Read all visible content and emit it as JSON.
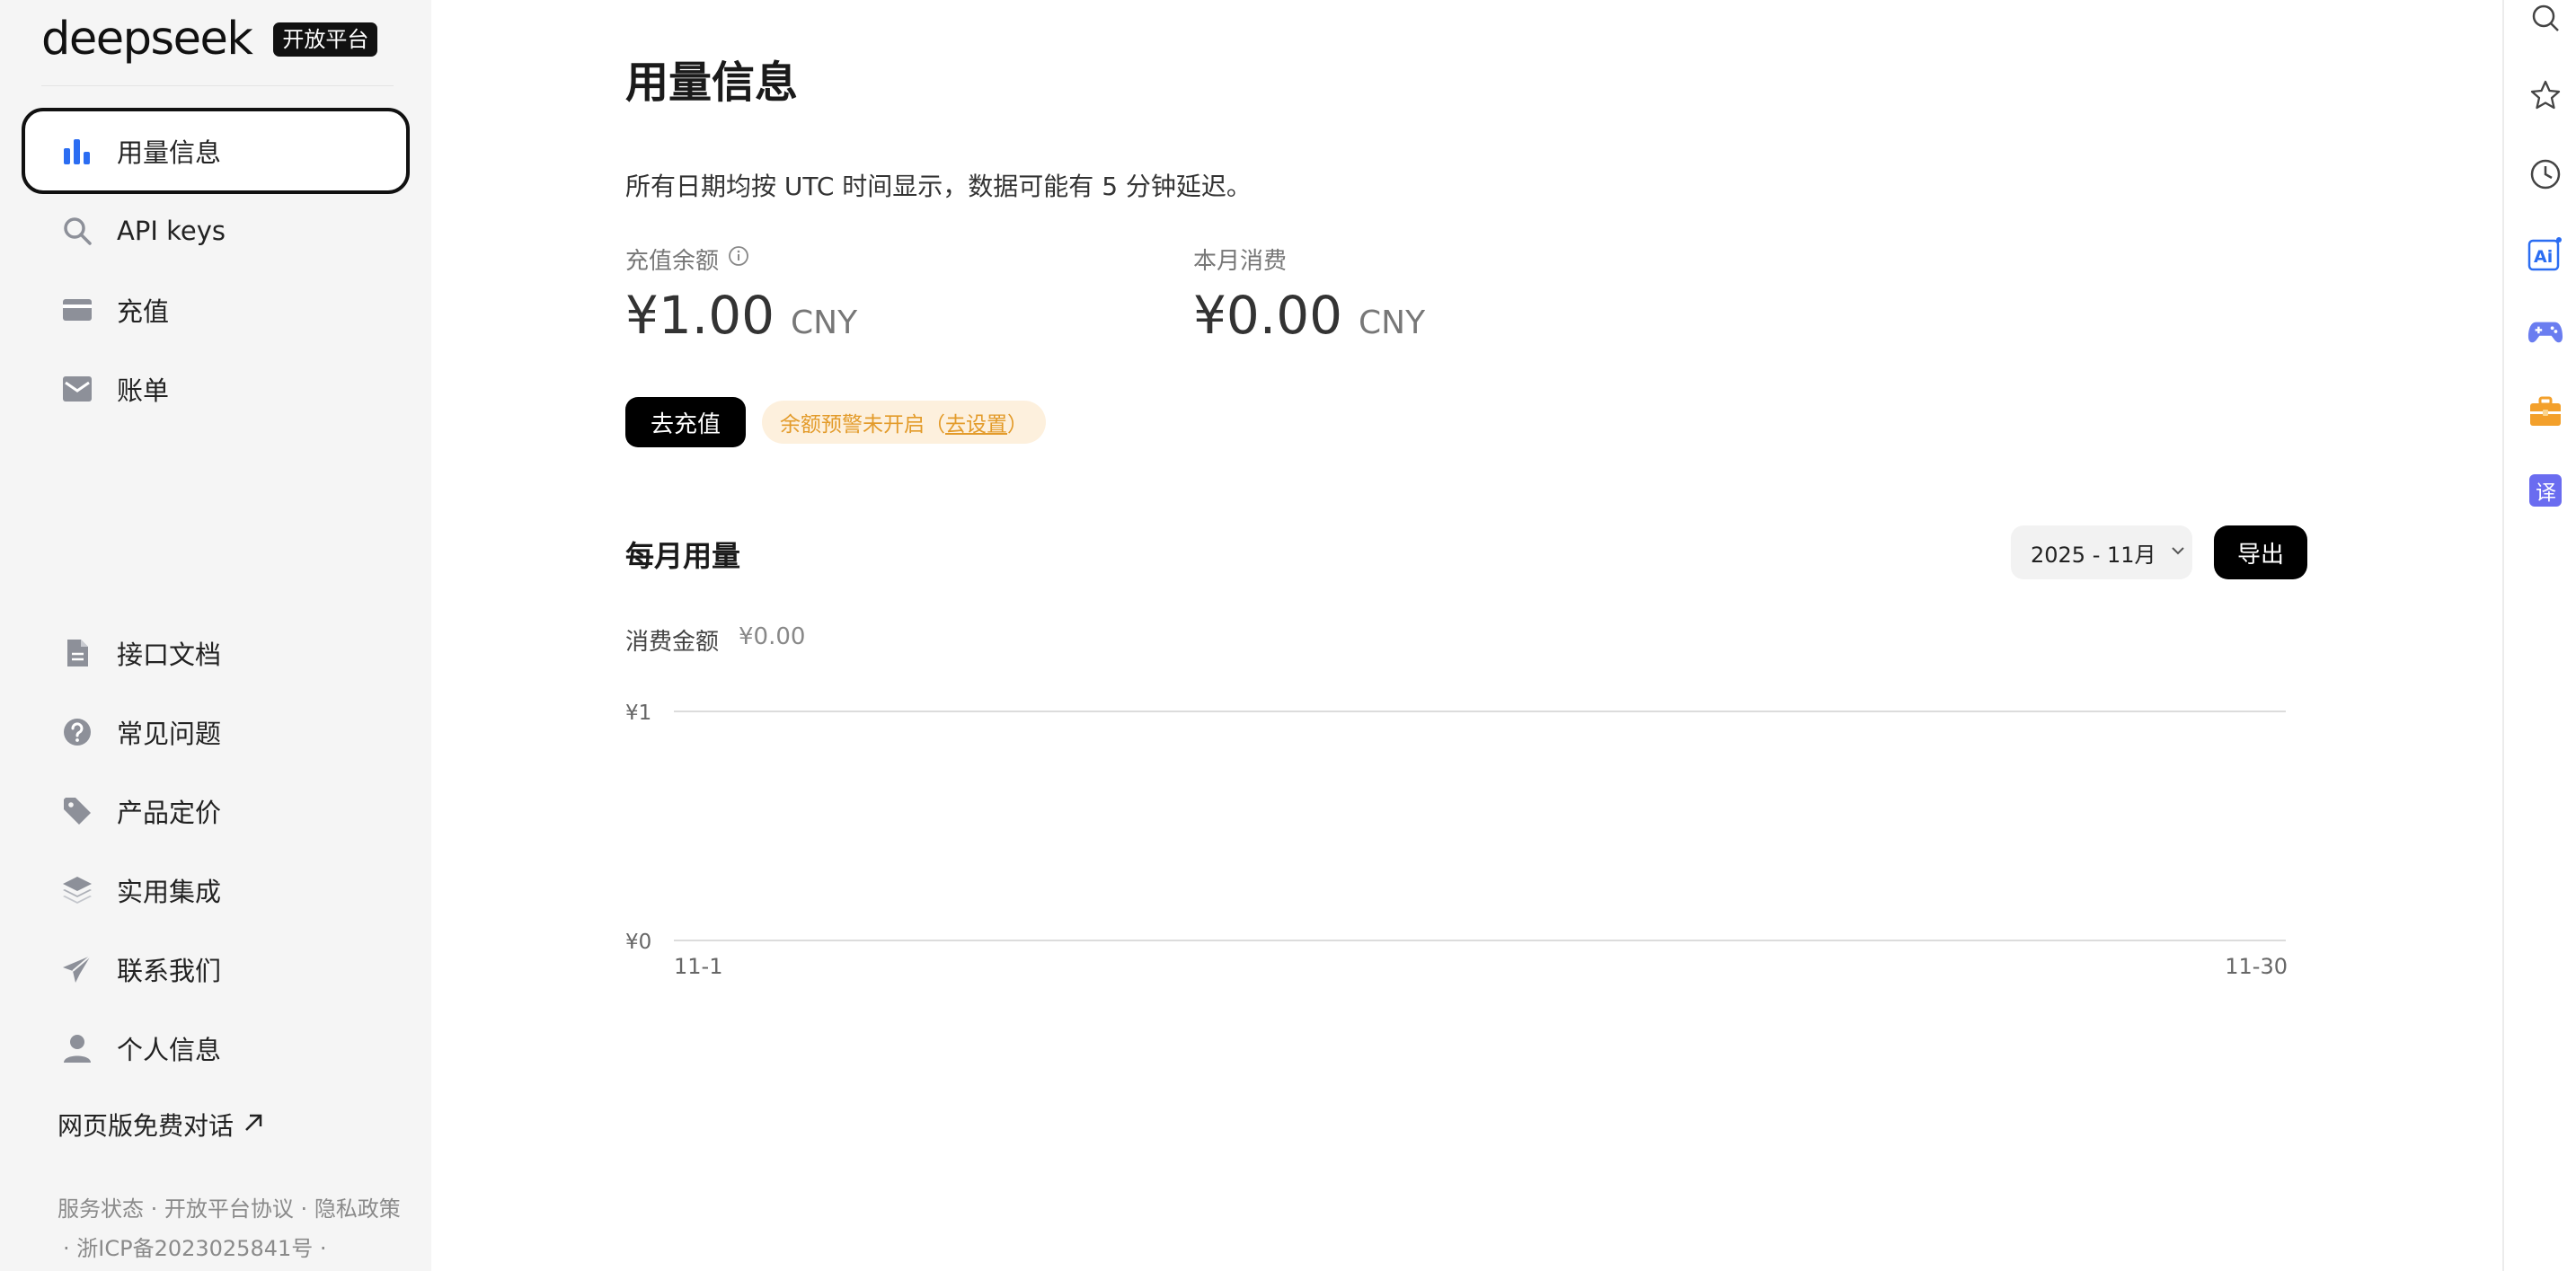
{
  "brand": {
    "logo": "deepseek",
    "badge": "开放平台"
  },
  "nav": [
    {
      "label": "用量信息",
      "icon": "bar-chart-icon",
      "active": true
    },
    {
      "label": "API keys",
      "icon": "search-icon"
    },
    {
      "label": "充值",
      "icon": "credit-card-icon"
    },
    {
      "label": "账单",
      "icon": "mail-icon"
    }
  ],
  "nav_bottom": [
    {
      "label": "接口文档",
      "icon": "document-icon"
    },
    {
      "label": "常见问题",
      "icon": "help-icon"
    },
    {
      "label": "产品定价",
      "icon": "tag-icon"
    },
    {
      "label": "实用集成",
      "icon": "layers-icon"
    },
    {
      "label": "联系我们",
      "icon": "send-icon"
    },
    {
      "label": "个人信息",
      "icon": "user-icon"
    }
  ],
  "web_chat": "网页版免费对话",
  "footer": {
    "links": [
      "服务状态",
      "开放平台协议",
      "隐私政策"
    ],
    "icp": "· 浙ICP备2023025841号 ·"
  },
  "main": {
    "title": "用量信息",
    "notice": "所有日期均按 UTC 时间显示，数据可能有 5 分钟延迟。",
    "balance": {
      "label": "充值余额",
      "amount": "¥1.00",
      "currency": "CNY"
    },
    "monthly_spend": {
      "label": "本月消费",
      "amount": "¥0.00",
      "currency": "CNY"
    },
    "topup_button": "去充值",
    "warning": {
      "text": "余额预警未开启（",
      "link": "去设置",
      "suffix": "）"
    },
    "monthly_usage": {
      "title": "每月用量",
      "month_select": "2025 - 11月",
      "export_button": "导出",
      "spend_label": "消费金额",
      "spend_value": "¥0.00"
    }
  },
  "chart_data": {
    "type": "line",
    "x_tick_labels": [
      "11-1",
      "11-30"
    ],
    "y_tick_labels": [
      "¥1",
      "¥0"
    ],
    "ylim": [
      0,
      1
    ],
    "series": [
      {
        "values": []
      }
    ],
    "grid": true
  },
  "rail": [
    {
      "icon": "search-icon"
    },
    {
      "icon": "star-icon"
    },
    {
      "icon": "clock-icon"
    },
    {
      "icon": "ai-icon",
      "text": "Ai",
      "color": "#2b6df2"
    },
    {
      "icon": "gamepad-icon",
      "color": "#6a7df0"
    },
    {
      "icon": "toolbox-icon",
      "color": "#f3a02b"
    },
    {
      "icon": "translate-icon",
      "text": "译",
      "color": "#6a6cf0"
    }
  ],
  "colors": {
    "accent": "#2b6df2",
    "warning_bg": "#fdf0dd",
    "warning_text": "#e39b2a"
  }
}
